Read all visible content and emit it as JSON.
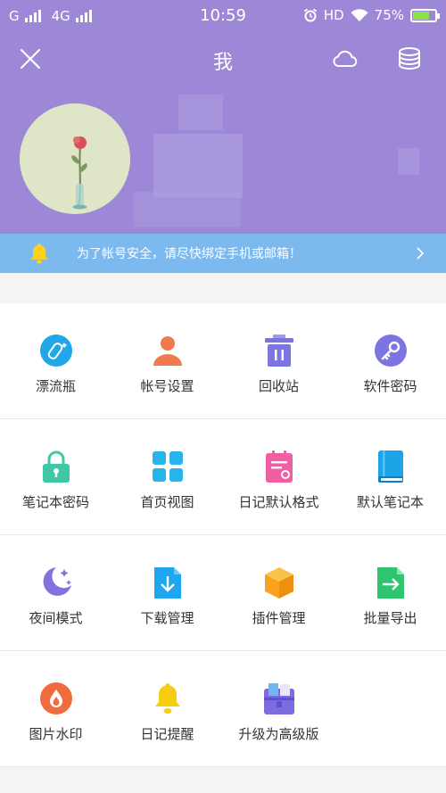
{
  "status_bar": {
    "carrier": "G",
    "network": "4G",
    "time": "10:59",
    "hd": "HD",
    "battery": "75%",
    "battery_level": 0.75
  },
  "header": {
    "title": "我",
    "bg_color": "#9c88d6",
    "icons": [
      "close-icon",
      "cloud-icon",
      "database-icon"
    ]
  },
  "notice": {
    "text": "为了帐号安全，请尽快绑定手机或邮箱！",
    "bg_color": "#7cb9ee"
  },
  "grid": {
    "items": [
      {
        "label": "漂流瓶",
        "icon": "bottle-icon",
        "color": "#1fa7ea"
      },
      {
        "label": "帐号设置",
        "icon": "user-icon",
        "color": "#f07a4e"
      },
      {
        "label": "回收站",
        "icon": "trash-icon",
        "color": "#7b74e2"
      },
      {
        "label": "软件密码",
        "icon": "key-icon",
        "color": "#7b74e2"
      },
      {
        "label": "笔记本密码",
        "icon": "lock-icon",
        "color": "#3fc7a6"
      },
      {
        "label": "首页视图",
        "icon": "grid-view-icon",
        "color": "#27b3ec"
      },
      {
        "label": "日记默认格式",
        "icon": "diary-format-icon",
        "color": "#f05ea3"
      },
      {
        "label": "默认笔记本",
        "icon": "notebook-icon",
        "color": "#1ca4e8"
      },
      {
        "label": "夜间模式",
        "icon": "moon-icon",
        "color": "#8471dd"
      },
      {
        "label": "下载管理",
        "icon": "download-icon",
        "color": "#1ea6ee"
      },
      {
        "label": "插件管理",
        "icon": "plugin-box-icon",
        "color": "#f8a21e"
      },
      {
        "label": "批量导出",
        "icon": "export-icon",
        "color": "#2fc46e"
      },
      {
        "label": "图片水印",
        "icon": "watermark-icon",
        "color": "#f06b3d"
      },
      {
        "label": "日记提醒",
        "icon": "bell-icon",
        "color": "#f8cd0f"
      },
      {
        "label": "升级为高级版",
        "icon": "premium-icon",
        "color": "#7b6ce0"
      }
    ]
  }
}
